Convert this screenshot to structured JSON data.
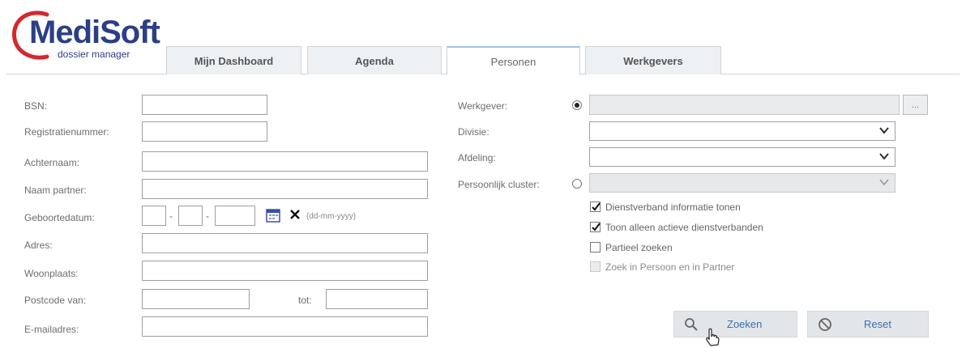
{
  "logo": {
    "title": "MediSoft",
    "subtitle": "dossier manager"
  },
  "tabs": [
    {
      "label": "Mijn Dashboard"
    },
    {
      "label": "Agenda"
    },
    {
      "label": "Personen",
      "active": true
    },
    {
      "label": "Werkgevers"
    }
  ],
  "form_left": {
    "bsn_label": "BSN:",
    "registratienummer_label": "Registratienummer:",
    "achternaam_label": "Achternaam:",
    "naam_partner_label": "Naam partner:",
    "geboortedatum_label": "Geboortedatum:",
    "date_separator": "-",
    "date_format_hint": "(dd-mm-yyyy)",
    "adres_label": "Adres:",
    "woonplaats_label": "Woonplaats:",
    "postcode_van_label": "Postcode van:",
    "postcode_tot_label": "tot:",
    "email_label": "E-mailadres:"
  },
  "form_right": {
    "werkgever_label": "Werkgever:",
    "werkgever_lookup_label": "...",
    "divisie_label": "Divisie:",
    "afdeling_label": "Afdeling:",
    "persoonlijk_cluster_label": "Persoonlijk cluster:",
    "checkboxes": [
      {
        "label": "Dienstverband informatie tonen",
        "checked": true,
        "disabled": false
      },
      {
        "label": "Toon alleen actieve dienstverbanden",
        "checked": true,
        "disabled": false
      },
      {
        "label": "Partieel zoeken",
        "checked": false,
        "disabled": false
      },
      {
        "label": "Zoek in Persoon en in Partner",
        "checked": false,
        "disabled": true
      }
    ]
  },
  "actions": {
    "zoeken_label": "Zoeken",
    "reset_label": "Reset"
  },
  "colors": {
    "brand_blue": "#2b3f86",
    "brand_red": "#d7262d",
    "button_text": "#3b6fb0"
  },
  "icons": [
    "calendar-icon",
    "clear-date-icon",
    "search-icon",
    "reset-icon",
    "chevron-down-icon",
    "hand-cursor-icon"
  ]
}
